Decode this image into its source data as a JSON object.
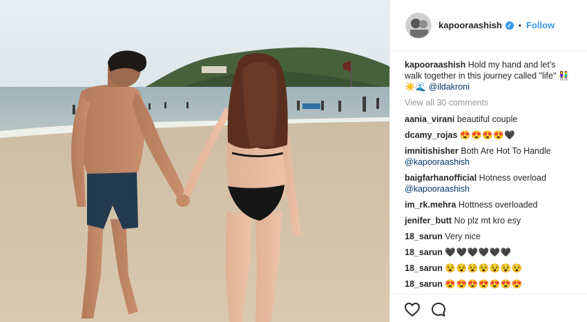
{
  "post": {
    "username": "kapooraashish",
    "follow_label": "Follow",
    "separator": "•",
    "caption_text_1": "Hold my hand and let's",
    "caption_text_2": "walk together in this journey called \"life\" 👫",
    "caption_emoji": "☀️🌊",
    "caption_mention": "@ildakroni",
    "view_all": "View all 30 comments"
  },
  "comments": [
    {
      "user": "aania_virani",
      "text": "beautiful couple"
    },
    {
      "user": "dcamy_rojas",
      "text": "😍😍😍😍🖤"
    },
    {
      "user": "imnitishisher",
      "text": "Both Are Hot To Handle",
      "mention": "@kapooraashish"
    },
    {
      "user": "baigfarhanofficial",
      "text": "Hotness overload",
      "mention": "@kapooraashish"
    },
    {
      "user": "im_rk.mehra",
      "text": "Hottness overloaded"
    },
    {
      "user": "jenifer_butt",
      "text": "No plz mt kro esy"
    },
    {
      "user": "18_sarun",
      "text": "Very nice"
    },
    {
      "user": "18_sarun",
      "text": "🖤🖤🖤🖤🖤🖤"
    },
    {
      "user": "18_sarun",
      "text": "😵😵😵😵😵😵😵"
    },
    {
      "user": "18_sarun",
      "text": "😍😍😍😍😍😍😍"
    }
  ],
  "actions": {
    "like_icon": "heart-icon",
    "comment_icon": "comment-icon"
  },
  "colors": {
    "link_blue": "#3897f0",
    "mention_blue": "#003569",
    "muted": "#999999",
    "text": "#262626"
  }
}
